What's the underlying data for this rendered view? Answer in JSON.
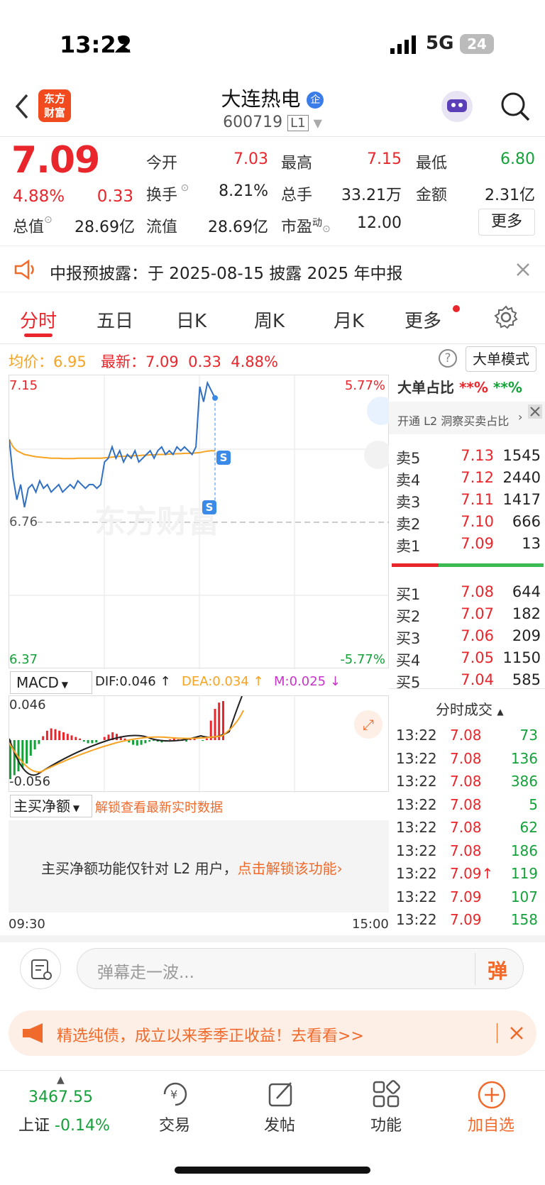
{
  "status": {
    "time": "13:22",
    "network": "5G",
    "battery": "24"
  },
  "header": {
    "title": "大连热电",
    "badge": "企",
    "code": "600719",
    "level": "L1",
    "logo_line1": "东方",
    "logo_line2": "财富"
  },
  "quote": {
    "price": "7.09",
    "change_pct": "4.88%",
    "change": "0.33",
    "open_label": "今开",
    "open": "7.03",
    "high_label": "最高",
    "high": "7.15",
    "low_label": "最低",
    "low": "6.80",
    "turnover_label": "换手",
    "turnover": "8.21%",
    "volume_label": "总手",
    "volume": "33.21万",
    "amount_label": "金额",
    "amount": "2.31亿",
    "mktcap_label": "总值",
    "mktcap": "28.69亿",
    "float_label": "流值",
    "float": "28.69亿",
    "pe_label": "市盈",
    "pe_sup": "动",
    "pe": "12.00",
    "more_button": "更多"
  },
  "notice": {
    "text": "中报预披露：于 2025-08-15 披露 2025 年中报"
  },
  "tabs": [
    "分时",
    "五日",
    "日K",
    "周K",
    "月K",
    "更多"
  ],
  "chart_header": {
    "avg_label": "均价：",
    "avg": "6.95",
    "latest_label": "最新：",
    "latest": "7.09",
    "chg": "0.33",
    "pct": "4.88%",
    "mode_button": "大单模式"
  },
  "chart_data": {
    "type": "line",
    "y_top": "7.15",
    "y_mid": "6.76",
    "y_bottom": "6.37",
    "pct_top": "5.77%",
    "pct_bottom": "-5.77%",
    "x_start": "09:30",
    "x_end": "15:00",
    "watermark": "东方财富",
    "ylim": [
      6.37,
      7.15
    ],
    "price": [
      6.98,
      6.88,
      6.82,
      6.86,
      6.8,
      6.85,
      6.86,
      6.84,
      6.87,
      6.85,
      6.86,
      6.84,
      6.85,
      6.86,
      6.84,
      6.85,
      6.86,
      6.85,
      6.87,
      6.86,
      6.85,
      6.86,
      6.86,
      6.85,
      6.86,
      6.92,
      6.93,
      6.96,
      6.93,
      6.95,
      6.92,
      6.94,
      6.93,
      6.95,
      6.92,
      6.93,
      6.94,
      6.95,
      6.93,
      6.95,
      6.96,
      6.94,
      6.95,
      6.94,
      6.96,
      6.95,
      6.96,
      6.95,
      6.94,
      6.96,
      7.12,
      7.08,
      7.13,
      7.11,
      7.09
    ],
    "avg": [
      6.98,
      6.96,
      6.95,
      6.945,
      6.94,
      6.938,
      6.936,
      6.934,
      6.933,
      6.932,
      6.931,
      6.93,
      6.93,
      6.93,
      6.929,
      6.929,
      6.929,
      6.929,
      6.93,
      6.93,
      6.93,
      6.93,
      6.93,
      6.93,
      6.93,
      6.931,
      6.932,
      6.933,
      6.934,
      6.935,
      6.935,
      6.936,
      6.936,
      6.937,
      6.937,
      6.938,
      6.938,
      6.939,
      6.939,
      6.94,
      6.94,
      6.94,
      6.941,
      6.941,
      6.942,
      6.942,
      6.943,
      6.943,
      6.943,
      6.944,
      6.945,
      6.947,
      6.949,
      6.95,
      6.95
    ]
  },
  "macd": {
    "selector": "MACD",
    "dif": "DIF:0.046",
    "dea": "DEA:0.034",
    "m": "M:0.025",
    "top": "0.046",
    "bottom": "-0.056",
    "bars": [
      -0.05,
      -0.045,
      -0.04,
      -0.035,
      -0.03,
      -0.02,
      -0.012,
      -0.005,
      0.005,
      0.012,
      0.015,
      0.014,
      0.012,
      0.01,
      0.008,
      0.006,
      0.004,
      0.002,
      -0.002,
      -0.004,
      -0.004,
      -0.003,
      0,
      0.004,
      0.007,
      0.01,
      0.008,
      0.005,
      0.002,
      -0.003,
      -0.006,
      -0.007,
      -0.006,
      -0.004,
      -0.002,
      -0.001,
      -0.002,
      -0.003,
      -0.002,
      0.001,
      0.002,
      0.001,
      -0.001,
      -0.002,
      0.001,
      0.002,
      0.0,
      -0.001,
      0.002,
      0.025,
      0.04,
      0.048,
      0.05
    ]
  },
  "net_buy": {
    "label": "主买净额",
    "unlock": "解锁查看最新实时数据",
    "msg": "主买净额功能仅针对 L2 用户，",
    "link": "点击解锁该功能"
  },
  "orderbook": {
    "title": "大单占比",
    "stars1": "**%",
    "stars2": "**%",
    "promo": "开通 L2 洞察买卖占比",
    "asks": [
      {
        "label": "卖5",
        "price": "7.13",
        "vol": "1545"
      },
      {
        "label": "卖4",
        "price": "7.12",
        "vol": "2440"
      },
      {
        "label": "卖3",
        "price": "7.11",
        "vol": "1417"
      },
      {
        "label": "卖2",
        "price": "7.10",
        "vol": "666"
      },
      {
        "label": "卖1",
        "price": "7.09",
        "vol": "13"
      }
    ],
    "bids": [
      {
        "label": "买1",
        "price": "7.08",
        "vol": "644"
      },
      {
        "label": "买2",
        "price": "7.07",
        "vol": "182"
      },
      {
        "label": "买3",
        "price": "7.06",
        "vol": "209"
      },
      {
        "label": "买4",
        "price": "7.05",
        "vol": "1150"
      },
      {
        "label": "买5",
        "price": "7.04",
        "vol": "585"
      }
    ]
  },
  "trades": {
    "title": "分时成交",
    "rows": [
      {
        "t": "13:22",
        "p": "7.08",
        "v": "73"
      },
      {
        "t": "13:22",
        "p": "7.08",
        "v": "136"
      },
      {
        "t": "13:22",
        "p": "7.08",
        "v": "386"
      },
      {
        "t": "13:22",
        "p": "7.08",
        "v": "5"
      },
      {
        "t": "13:22",
        "p": "7.08",
        "v": "62"
      },
      {
        "t": "13:22",
        "p": "7.08",
        "v": "186"
      },
      {
        "t": "13:22",
        "p": "7.09↑",
        "v": "119"
      },
      {
        "t": "13:22",
        "p": "7.09",
        "v": "107"
      },
      {
        "t": "13:22",
        "p": "7.09",
        "v": "158"
      }
    ]
  },
  "comment": {
    "placeholder": "弹幕走一波...",
    "btn": "弹"
  },
  "promo": {
    "text": "精选纯债，成立以来季季正收益！去看看>>"
  },
  "bottom": {
    "index_value": "3467.55",
    "index_name": "上证",
    "index_chg": "-0.14%",
    "items": [
      "交易",
      "发帖",
      "功能",
      "加自选"
    ]
  }
}
